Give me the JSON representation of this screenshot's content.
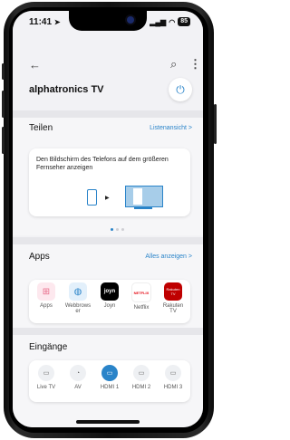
{
  "status": {
    "time": "11:41",
    "battery": "85"
  },
  "header": {
    "back_icon": "arrow-left-icon",
    "search_icon": "search-icon",
    "menu_icon": "more-vert-icon",
    "title": "alphatronics TV",
    "power_icon": "power-icon"
  },
  "share": {
    "title": "Teilen",
    "link": "Listenansicht  >",
    "card_text": "Den Bildschirm des Telefons auf dem größeren Fernseher anzeigen"
  },
  "apps": {
    "title": "Apps",
    "link": "Alles anzeigen  >",
    "items": [
      {
        "label": "Apps",
        "icon": "grid-icon",
        "color": "#e86b8a"
      },
      {
        "label": "Webbrows\ner",
        "icon": "globe-icon",
        "color": "#2a84c9"
      },
      {
        "label": "Joyn",
        "icon_text": "joyn",
        "color": "#000000"
      },
      {
        "label": "Netflix",
        "icon_text": "NETFLIX",
        "color": "#e50914"
      },
      {
        "label": "Rakuten\nTV",
        "icon_text": "Rakuten TV",
        "color": "#bf0000"
      }
    ]
  },
  "inputs": {
    "title": "Eingänge",
    "items": [
      {
        "label": "Live TV",
        "icon": "tv-icon"
      },
      {
        "label": "AV",
        "icon": "av-icon"
      },
      {
        "label": "HDMI 1",
        "icon": "hdmi-icon",
        "active": true
      },
      {
        "label": "HDMI 2",
        "icon": "hdmi-icon"
      },
      {
        "label": "HDMI 3",
        "icon": "hdmi-icon"
      }
    ]
  },
  "colors": {
    "accent": "#2a84c9",
    "background": "#f2f2f5"
  }
}
